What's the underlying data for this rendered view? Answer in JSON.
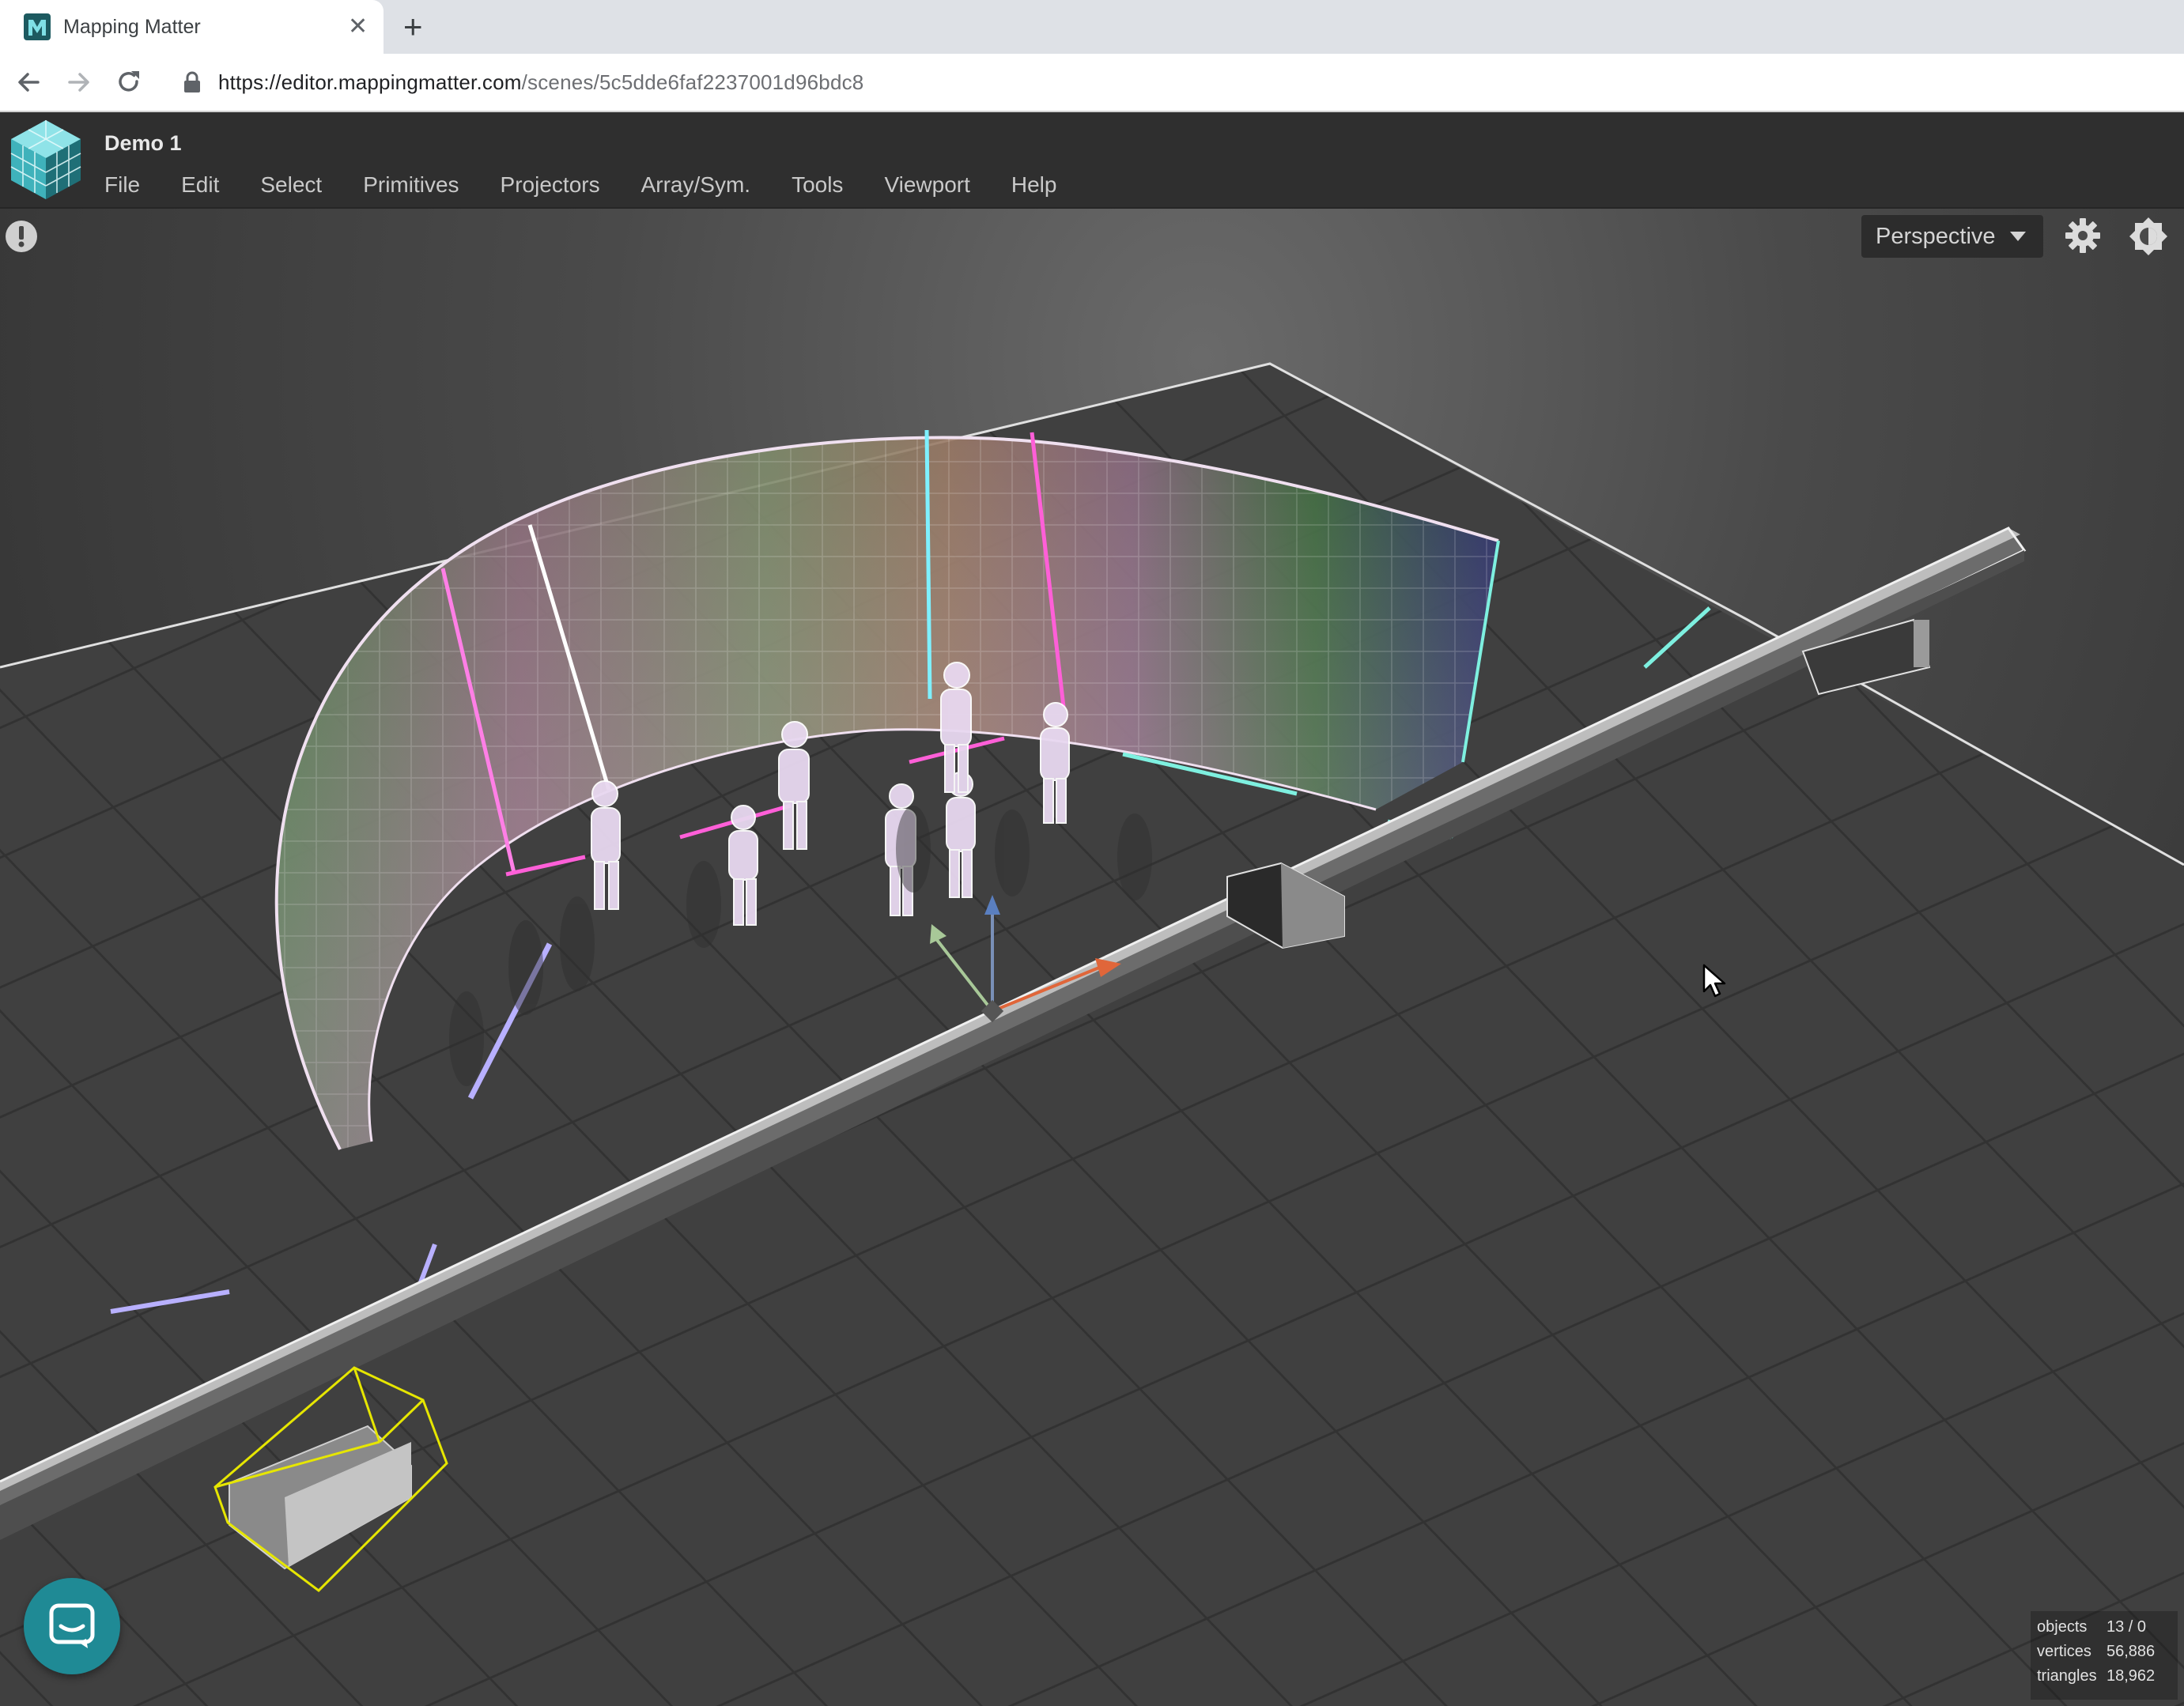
{
  "browser": {
    "tab_title": "Mapping Matter",
    "tab_close": "✕",
    "new_tab": "+",
    "url_host": "https://editor.mappingmatter.com",
    "url_path": "/scenes/5c5dde6faf2237001d96bdc8"
  },
  "app": {
    "project_title": "Demo 1",
    "menu": [
      "File",
      "Edit",
      "Select",
      "Primitives",
      "Projectors",
      "Array/Sym.",
      "Tools",
      "Viewport",
      "Help"
    ]
  },
  "viewport": {
    "camera_mode": "Perspective",
    "stats": {
      "objects_label": "objects",
      "objects_value": "13 / 0",
      "vertices_label": "vertices",
      "vertices_value": "56,886",
      "triangles_label": "triangles",
      "triangles_value": "18,962"
    }
  },
  "colors": {
    "accent_teal": "#1f8a95",
    "selection_yellow": "#e6e600",
    "header_bg": "#2f2f2f"
  },
  "icons": [
    "mapping-matter-logo",
    "back-arrow-icon",
    "forward-arrow-icon",
    "reload-icon",
    "lock-icon",
    "alert-icon",
    "chevron-down-icon",
    "gear-icon",
    "brightness-icon",
    "chat-icon",
    "cursor-icon"
  ]
}
